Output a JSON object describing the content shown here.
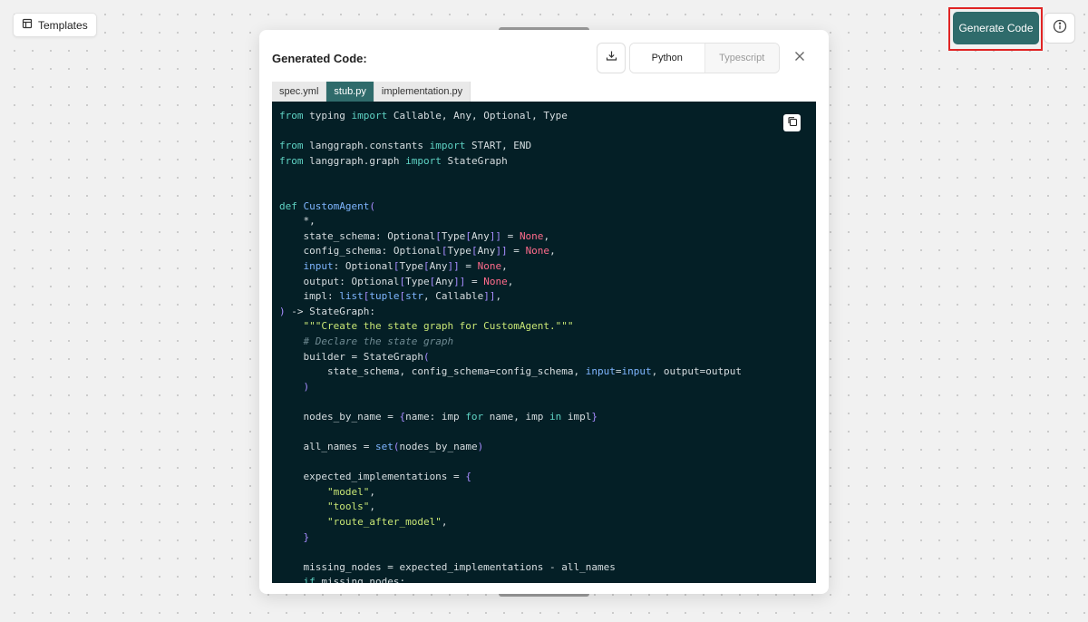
{
  "toolbar": {
    "templates_label": "Templates",
    "generate_label": "Generate Code"
  },
  "modal": {
    "title": "Generated Code:",
    "languages": [
      "Python",
      "Typescript"
    ],
    "active_language": "Python",
    "file_tabs": [
      "spec.yml",
      "stub.py",
      "implementation.py"
    ],
    "active_file": "stub.py"
  },
  "code_lines": [
    [
      [
        "from",
        "kw"
      ],
      [
        " typing ",
        ""
      ],
      [
        "import",
        "kw"
      ],
      [
        " Callable, Any, Optional, Type",
        ""
      ]
    ],
    [],
    [
      [
        "from",
        "kw"
      ],
      [
        " langgraph.constants ",
        ""
      ],
      [
        "import",
        "kw"
      ],
      [
        " START, END",
        ""
      ]
    ],
    [
      [
        "from",
        "kw"
      ],
      [
        " langgraph.graph ",
        ""
      ],
      [
        "import",
        "kw"
      ],
      [
        " StateGraph",
        ""
      ]
    ],
    [],
    [],
    [
      [
        "def",
        "kw"
      ],
      [
        " ",
        ""
      ],
      [
        "CustomAgent",
        "fn"
      ],
      [
        "(",
        "pr"
      ]
    ],
    [
      [
        "    *,",
        ""
      ]
    ],
    [
      [
        "    state_schema: Optional",
        "",
        ""
      ],
      [
        "[",
        "pr"
      ],
      [
        "Type",
        "",
        ""
      ],
      [
        "[",
        "pr"
      ],
      [
        "Any",
        "",
        ""
      ],
      [
        "]]",
        "pr"
      ],
      [
        " = ",
        ""
      ],
      [
        "None",
        "nn"
      ],
      [
        ",",
        ""
      ]
    ],
    [
      [
        "    config_schema: Optional",
        ""
      ],
      [
        "[",
        "pr"
      ],
      [
        "Type",
        ""
      ],
      [
        "[",
        "pr"
      ],
      [
        "Any",
        ""
      ],
      [
        "]]",
        "pr"
      ],
      [
        " = ",
        ""
      ],
      [
        "None",
        "nn"
      ],
      [
        ",",
        ""
      ]
    ],
    [
      [
        "    ",
        ""
      ],
      [
        "input",
        "bt"
      ],
      [
        ": Optional",
        ""
      ],
      [
        "[",
        "pr"
      ],
      [
        "Type",
        ""
      ],
      [
        "[",
        "pr"
      ],
      [
        "Any",
        ""
      ],
      [
        "]]",
        "pr"
      ],
      [
        " = ",
        ""
      ],
      [
        "None",
        "nn"
      ],
      [
        ",",
        ""
      ]
    ],
    [
      [
        "    output: Optional",
        ""
      ],
      [
        "[",
        "pr"
      ],
      [
        "Type",
        ""
      ],
      [
        "[",
        "pr"
      ],
      [
        "Any",
        ""
      ],
      [
        "]]",
        "pr"
      ],
      [
        " = ",
        ""
      ],
      [
        "None",
        "nn"
      ],
      [
        ",",
        ""
      ]
    ],
    [
      [
        "    impl: ",
        ""
      ],
      [
        "list",
        "bt"
      ],
      [
        "[",
        "pr"
      ],
      [
        "tuple",
        "bt"
      ],
      [
        "[",
        "pr"
      ],
      [
        "str",
        "bt"
      ],
      [
        ", Callable",
        ""
      ],
      [
        "]]",
        "pr"
      ],
      [
        ",",
        ""
      ]
    ],
    [
      [
        ")",
        "pr"
      ],
      [
        " -> StateGraph:",
        ""
      ]
    ],
    [
      [
        "    ",
        ""
      ],
      [
        "\"\"\"Create the state graph for CustomAgent.\"\"\"",
        "st"
      ]
    ],
    [
      [
        "    ",
        ""
      ],
      [
        "# Declare the state graph",
        "cm"
      ]
    ],
    [
      [
        "    builder = StateGraph",
        ""
      ],
      [
        "(",
        "pr"
      ]
    ],
    [
      [
        "        state_schema, config_schema=config_schema, ",
        ""
      ],
      [
        "input",
        "bt"
      ],
      [
        "=",
        ""
      ],
      [
        "input",
        "bt"
      ],
      [
        ", output=output",
        ""
      ]
    ],
    [
      [
        "    ",
        ""
      ],
      [
        ")",
        "pr"
      ]
    ],
    [],
    [
      [
        "    nodes_by_name = ",
        ""
      ],
      [
        "{",
        "pr"
      ],
      [
        "name: imp ",
        ""
      ],
      [
        "for",
        "kw"
      ],
      [
        " name, imp ",
        ""
      ],
      [
        "in",
        "kw"
      ],
      [
        " impl",
        ""
      ],
      [
        "}",
        "pr"
      ]
    ],
    [],
    [
      [
        "    all_names = ",
        ""
      ],
      [
        "set",
        "bt"
      ],
      [
        "(",
        "pr"
      ],
      [
        "nodes_by_name",
        ""
      ],
      [
        ")",
        "pr"
      ]
    ],
    [],
    [
      [
        "    expected_implementations = ",
        ""
      ],
      [
        "{",
        "pr"
      ]
    ],
    [
      [
        "        ",
        ""
      ],
      [
        "\"model\"",
        "st"
      ],
      [
        ",",
        ""
      ]
    ],
    [
      [
        "        ",
        ""
      ],
      [
        "\"tools\"",
        "st"
      ],
      [
        ",",
        ""
      ]
    ],
    [
      [
        "        ",
        ""
      ],
      [
        "\"route_after_model\"",
        "st"
      ],
      [
        ",",
        ""
      ]
    ],
    [
      [
        "    ",
        ""
      ],
      [
        "}",
        "pr"
      ]
    ],
    [],
    [
      [
        "    missing_nodes = expected_implementations - all_names",
        ""
      ]
    ],
    [
      [
        "    ",
        ""
      ],
      [
        "if",
        "kw"
      ],
      [
        " missing_nodes:",
        ""
      ]
    ]
  ]
}
